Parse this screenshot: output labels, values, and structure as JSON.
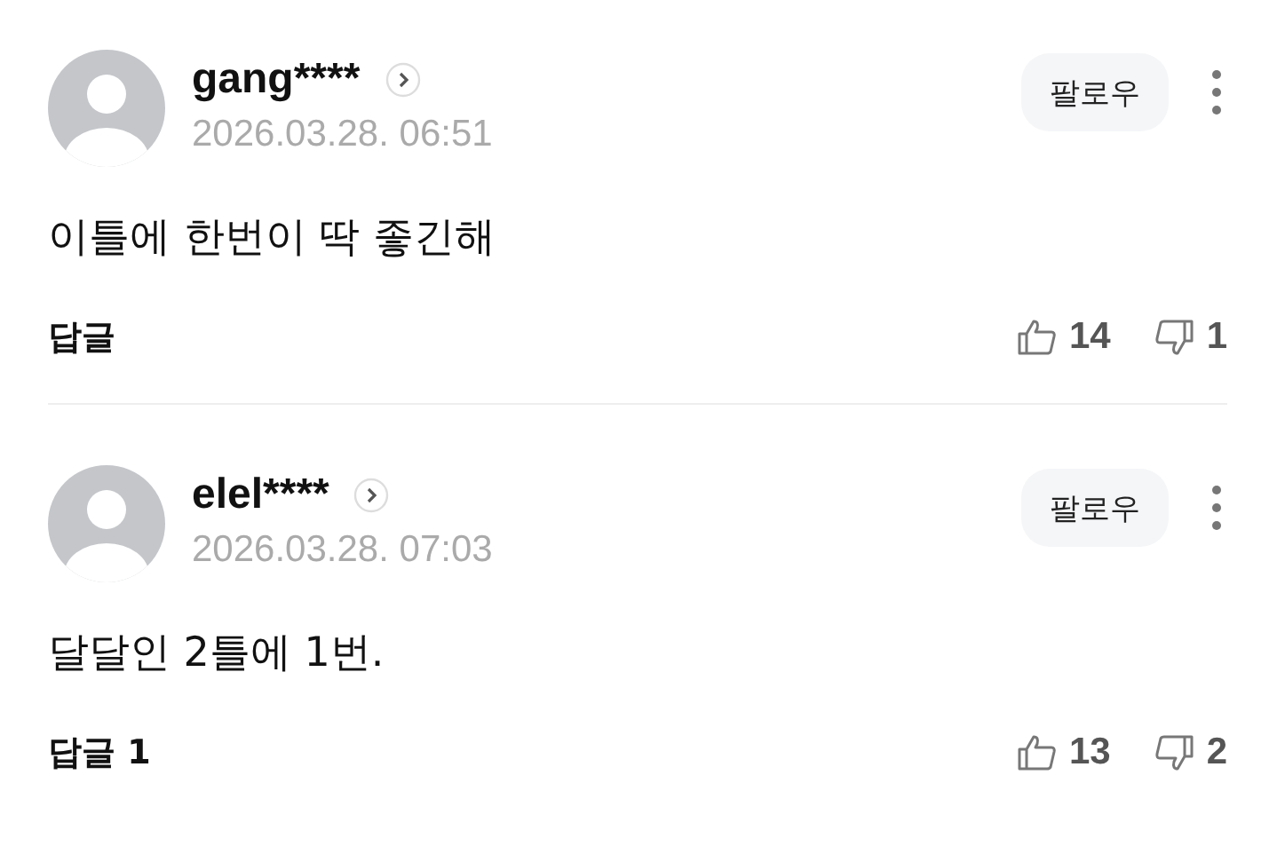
{
  "comments": [
    {
      "username": "gang****",
      "date": "2026.03.28. 06:51",
      "follow_label": "팔로우",
      "text": "이틀에 한번이 딱 좋긴해",
      "reply_label": "답글",
      "likes": "14",
      "dislikes": "1"
    },
    {
      "username": "elel****",
      "date": "2026.03.28. 07:03",
      "follow_label": "팔로우",
      "text": "달달인 2틀에 1번.",
      "reply_label": "답글 1",
      "likes": "13",
      "dislikes": "2"
    }
  ]
}
